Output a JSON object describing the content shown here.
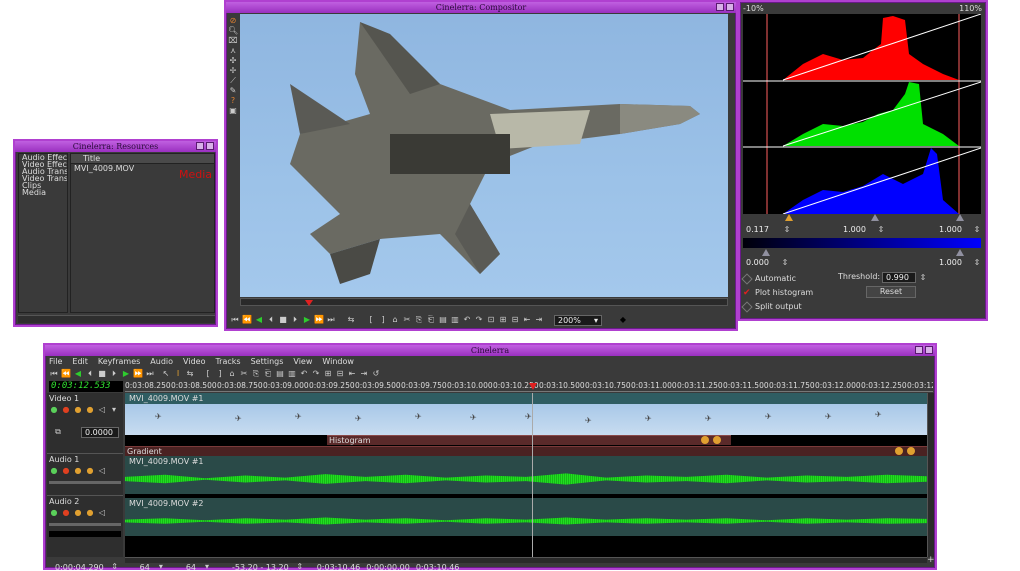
{
  "resources": {
    "title": "Cinelerra: Resources",
    "folders": [
      "Audio Effects",
      "Video Effects",
      "Audio Transitions",
      "Video Transitions",
      "Clips",
      "Media"
    ],
    "column_title": "Title",
    "item": "MVI_4009.MOV",
    "watermark": "Media"
  },
  "compositor": {
    "title": "Cinelerra: Compositor",
    "zoom": "200%"
  },
  "histogram": {
    "min_label": "-10%",
    "max_label": "110%",
    "in_min": "0.117",
    "in_mid": "1.000",
    "in_max": "1.000",
    "out_min": "0.000",
    "out_max": "1.000",
    "automatic": "Automatic",
    "plot": "Plot histogram",
    "split": "Split output",
    "threshold_label": "Threshold:",
    "threshold": "0.990",
    "reset": "Reset"
  },
  "main": {
    "title": "Cinelerra",
    "menu": [
      "File",
      "Edit",
      "Keyframes",
      "Audio",
      "Video",
      "Tracks",
      "Settings",
      "View",
      "Window"
    ],
    "clock": "0:03:12.533",
    "ruler": [
      "0:03:08.250",
      "0:03:08.500",
      "0:03:08.750",
      "0:03:09.000",
      "0:03:09.250",
      "0:03:09.500",
      "0:03:09.750",
      "0:03:10.000",
      "0:03:10.250",
      "0:03:10.500",
      "0:03:10.750",
      "0:03:11.000",
      "0:03:11.250",
      "0:03:11.500",
      "0:03:11.750",
      "0:03:12.000",
      "0:03:12.250",
      "0:03:12"
    ],
    "tracks": {
      "video1": "Video 1",
      "video1_clip": "MVI_4009.MOV #1",
      "fade": "0.0000",
      "effect1": "Histogram",
      "effect2": "Gradient",
      "audio1": "Audio 1",
      "audio1_clip": "MVI_4009.MOV #1",
      "audio2": "Audio 2",
      "audio2_clip": "MVI_4009.MOV #2"
    },
    "status": {
      "s1": "0:00:04.290",
      "s2": "64",
      "s3": "64",
      "s4": "-53.20 - 13.20",
      "s5": "0:03:10.46",
      "s6": "0:00:00.00",
      "s7": "0:03:10.46"
    }
  },
  "colors": {
    "window_border": "#b040d0",
    "accent_green": "#2ecc2e",
    "hist_red": "#ff0000",
    "hist_green": "#00e000",
    "hist_blue": "#0000ff"
  }
}
